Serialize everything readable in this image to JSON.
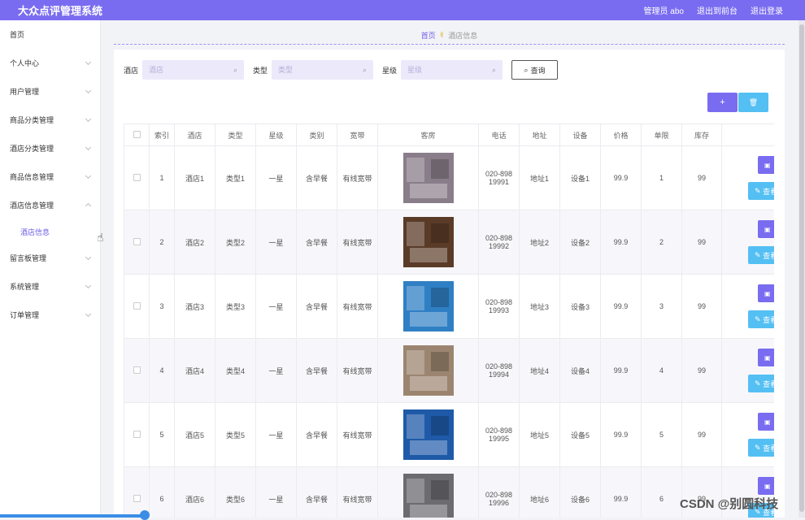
{
  "header": {
    "title": "大众点评管理系统",
    "user_label": "管理员 abo",
    "frontend_link": "退出到前台",
    "logout_link": "退出登录"
  },
  "sidebar": {
    "items": [
      {
        "label": "首页"
      },
      {
        "label": "个人中心"
      },
      {
        "label": "用户管理"
      },
      {
        "label": "商品分类管理"
      },
      {
        "label": "酒店分类管理"
      },
      {
        "label": "商品信息管理"
      },
      {
        "label": "酒店信息管理"
      },
      {
        "label": "留言板管理"
      },
      {
        "label": "系统管理"
      },
      {
        "label": "订单管理"
      }
    ],
    "active_sub": "酒店信息"
  },
  "breadcrumb": {
    "home": "首页",
    "current": "酒店信息"
  },
  "search": {
    "hotel_label": "酒店",
    "hotel_placeholder": "酒店",
    "type_label": "类型",
    "type_placeholder": "类型",
    "star_label": "星级",
    "star_placeholder": "星级",
    "query_label": "查询"
  },
  "toolbar": {
    "add_icon": "+",
    "delete_icon": "🗑"
  },
  "table": {
    "columns": [
      "索引",
      "酒店",
      "类型",
      "星级",
      "类别",
      "宽带",
      "客房",
      "电话",
      "地址",
      "设备",
      "价格",
      "单限",
      "库存"
    ],
    "rows": [
      {
        "index": "1",
        "hotel": "酒店1",
        "type": "类型1",
        "star": "一星",
        "category": "含早餐",
        "broadband": "有线宽带",
        "phone1": "020-898",
        "phone2": "19991",
        "address": "地址1",
        "equipment": "设备1",
        "price": "99.9",
        "limit": "1",
        "stock": "99",
        "photo": "#8a7d8a"
      },
      {
        "index": "2",
        "hotel": "酒店2",
        "type": "类型2",
        "star": "一星",
        "category": "含早餐",
        "broadband": "有线宽带",
        "phone1": "020-898",
        "phone2": "19992",
        "address": "地址2",
        "equipment": "设备2",
        "price": "99.9",
        "limit": "2",
        "stock": "99",
        "photo": "#5a3b28"
      },
      {
        "index": "3",
        "hotel": "酒店3",
        "type": "类型3",
        "star": "一星",
        "category": "含早餐",
        "broadband": "有线宽带",
        "phone1": "020-898",
        "phone2": "19993",
        "address": "地址3",
        "equipment": "设备3",
        "price": "99.9",
        "limit": "3",
        "stock": "99",
        "photo": "#2f7fc4"
      },
      {
        "index": "4",
        "hotel": "酒店4",
        "type": "类型4",
        "star": "一星",
        "category": "含早餐",
        "broadband": "有线宽带",
        "phone1": "020-898",
        "phone2": "19994",
        "address": "地址4",
        "equipment": "设备4",
        "price": "99.9",
        "limit": "4",
        "stock": "99",
        "photo": "#9c8570"
      },
      {
        "index": "5",
        "hotel": "酒店5",
        "type": "类型5",
        "star": "一星",
        "category": "含早餐",
        "broadband": "有线宽带",
        "phone1": "020-898",
        "phone2": "19995",
        "address": "地址5",
        "equipment": "设备5",
        "price": "99.9",
        "limit": "5",
        "stock": "99",
        "photo": "#1e5aa8"
      },
      {
        "index": "6",
        "hotel": "酒店6",
        "type": "类型6",
        "star": "一星",
        "category": "含早餐",
        "broadband": "有线宽带",
        "phone1": "020-898",
        "phone2": "19996",
        "address": "地址6",
        "equipment": "设备6",
        "price": "99.9",
        "limit": "6",
        "stock": "99",
        "photo": "#6b6b70"
      }
    ],
    "op_view": "查看"
  },
  "watermark": "CSDN @别圆科技",
  "colors": {
    "accent": "#7a6cf0",
    "info": "#54bff3"
  }
}
